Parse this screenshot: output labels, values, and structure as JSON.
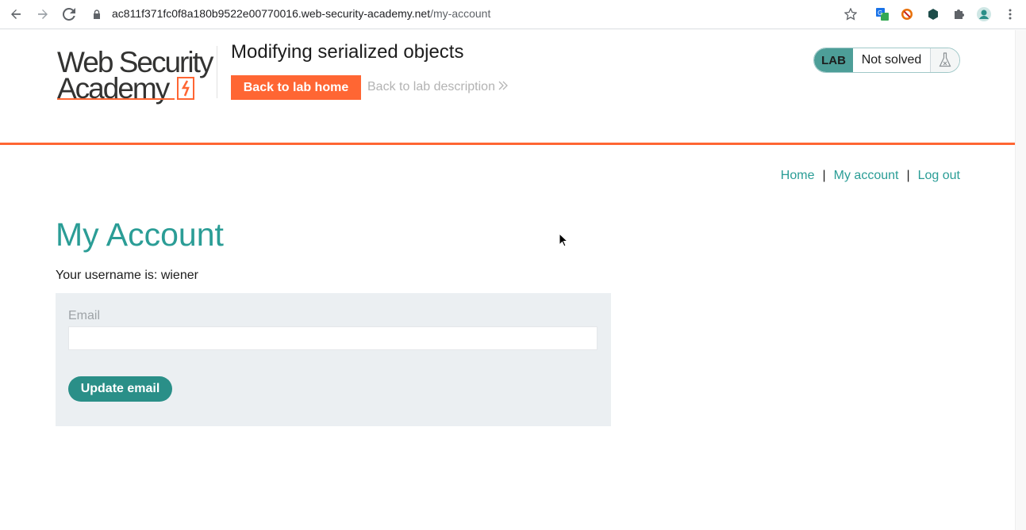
{
  "browser": {
    "url_host": "ac811f371fc0f8a180b9522e00770016.web-security-academy.net",
    "url_path": "/my-account"
  },
  "header": {
    "logo_line1": "Web Security",
    "logo_line2": "Academy",
    "lab_title": "Modifying serialized objects",
    "back_to_lab_home": "Back to lab home",
    "back_to_lab_description": "Back to lab description",
    "status_tag": "LAB",
    "status_text": "Not solved"
  },
  "nav": {
    "home": "Home",
    "sep1": "|",
    "my_account": "My account",
    "sep2": "|",
    "log_out": "Log out"
  },
  "main": {
    "heading": "My Account",
    "username_text": "Your username is: wiener",
    "email_label": "Email",
    "email_value": "",
    "update_button": "Update email"
  },
  "colors": {
    "accent_orange": "#ff6633",
    "accent_teal": "#2a9d96"
  }
}
